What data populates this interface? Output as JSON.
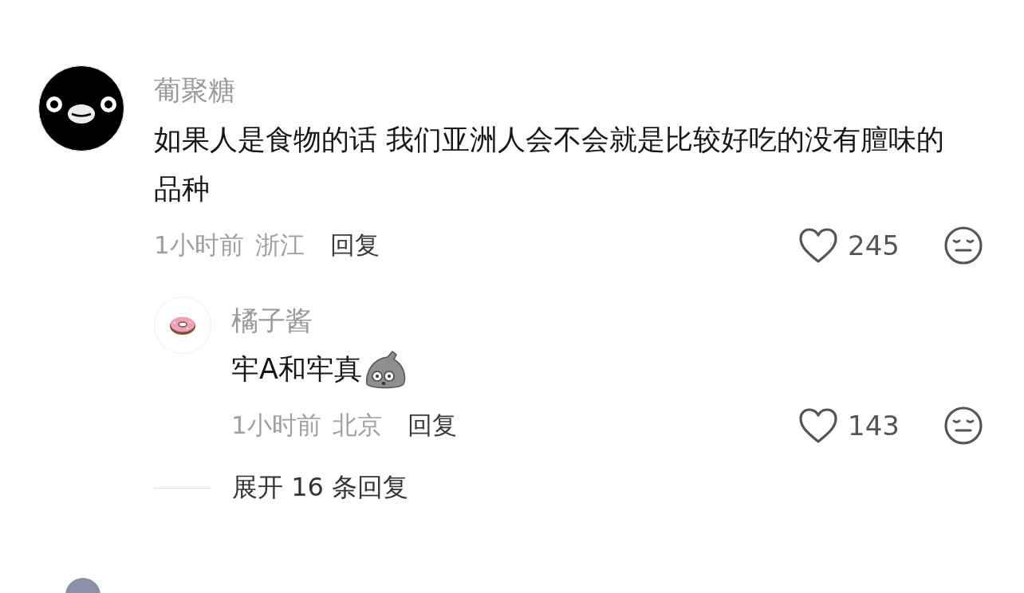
{
  "comments": [
    {
      "user": "葡聚糖",
      "text": "如果人是食物的话 我们亚洲人会不会就是比较好吃的没有膻味的品种",
      "time": "1小时前",
      "location": "浙江",
      "reply_label": "回复",
      "likes": "245",
      "replies": [
        {
          "user": "橘子酱",
          "text": "牢A和牢真",
          "time": "1小时前",
          "location": "北京",
          "reply_label": "回复",
          "likes": "143"
        }
      ],
      "expand_label": "展开 16 条回复"
    }
  ]
}
